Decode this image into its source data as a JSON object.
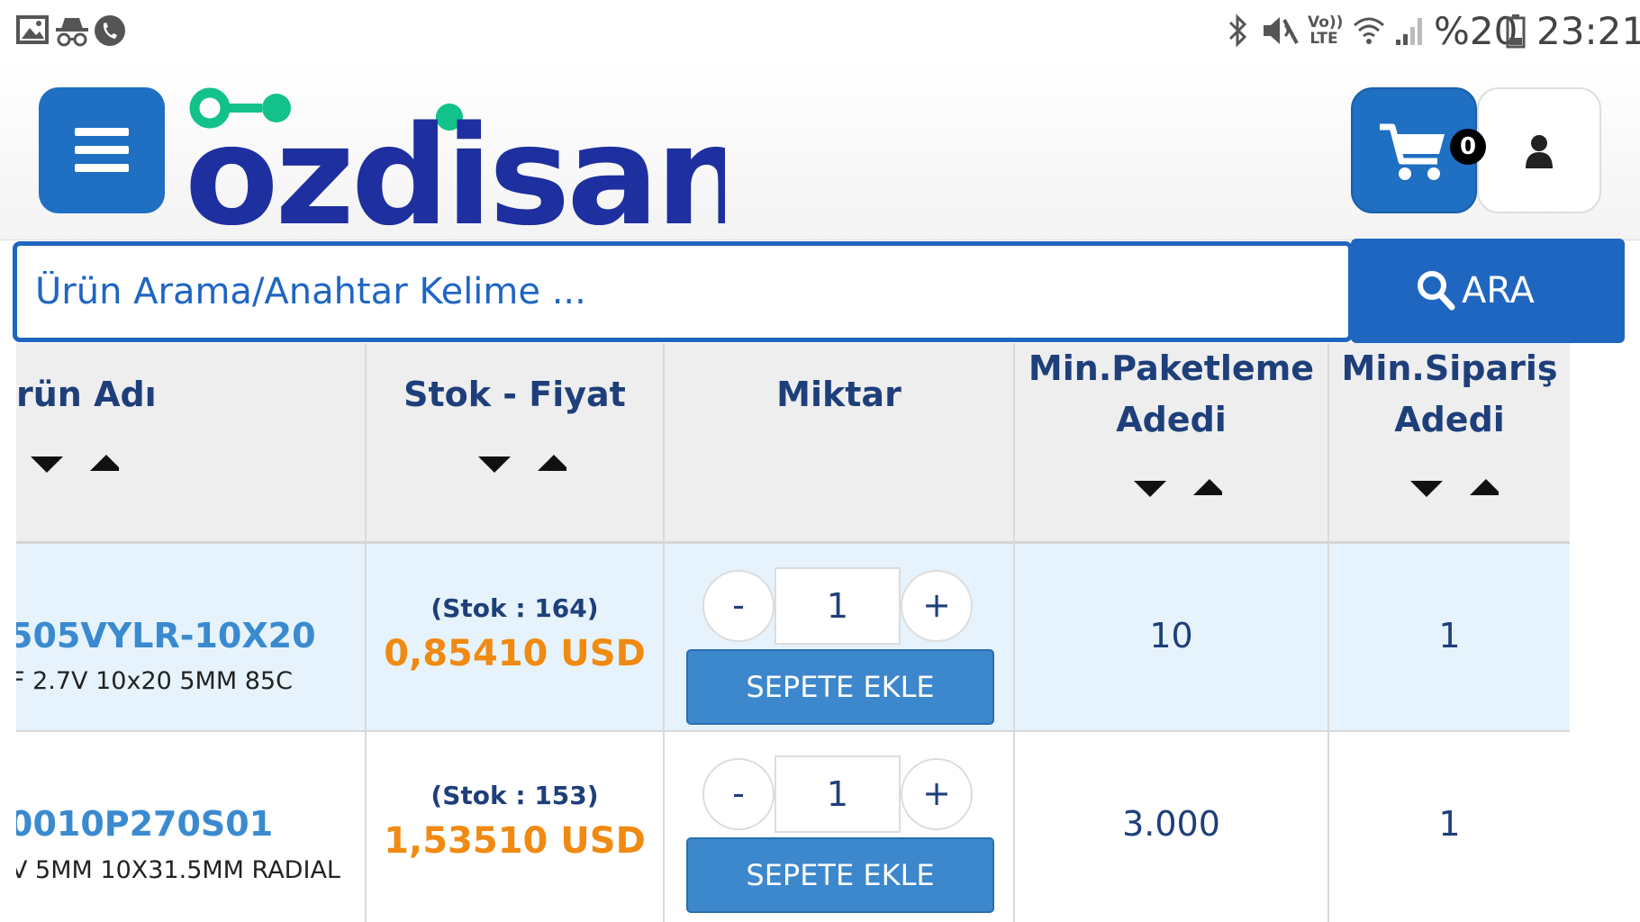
{
  "status_bar": {
    "battery": "%20",
    "time": "23:21",
    "network_label": "Vo)) LTE"
  },
  "header": {
    "logo_text": "ozdisan",
    "cart_count": "0"
  },
  "search": {
    "placeholder": "Ürün Arama/Anahtar Kelime ...",
    "button_label": "ARA"
  },
  "table": {
    "headers": {
      "name": "rün Adı",
      "stock_price": "Stok - Fiyat",
      "quantity": "Miktar",
      "min_pack_1": "Min.Paketleme",
      "min_pack_2": "Adedi",
      "min_order_1": "Min.Sipariş",
      "min_order_2": "Adedi"
    },
    "rows": [
      {
        "name": "505VYLR-10X20",
        "description": "F 2.7V 10x20 5MM 85C",
        "stock": "(Stok : 164)",
        "price": "0,85410 USD",
        "qty": "1",
        "minus": "-",
        "plus": "+",
        "add_label": "SEPETE EKLE",
        "min_pack": "10",
        "min_order": "1"
      },
      {
        "name": "0010P270S01",
        "description": "V 5MM 10X31.5MM RADIAL",
        "stock": "(Stok : 153)",
        "price": "1,53510 USD",
        "qty": "1",
        "minus": "-",
        "plus": "+",
        "add_label": "SEPETE EKLE",
        "min_pack": "3.000",
        "min_order": "1"
      }
    ]
  },
  "colors": {
    "brand_blue": "#1f66c1",
    "logo_navy": "#1e2fa0",
    "logo_green": "#12c28a",
    "price_orange": "#f08a12",
    "row_highlight": "#e6f3fc"
  }
}
